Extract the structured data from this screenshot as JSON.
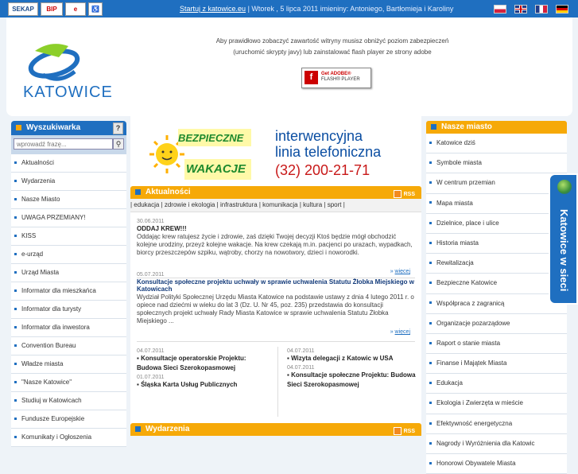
{
  "topbar": {
    "logos": [
      "SEKAP",
      "BIP",
      "e",
      "♿"
    ],
    "start_link": "Startuj z katowice.eu",
    "date_text": "| Wtorek , 5 lipca 2011 imieniny: Antoniego, Bartłomieja i Karoliny",
    "flags": [
      "pl-flag",
      "en-flag",
      "fr-flag",
      "de-flag"
    ]
  },
  "header": {
    "logo_text": "KATOWICE",
    "notice_line1": "Aby prawidłowo zobaczyć zawartość witryny musisz obniżyć poziom zabezpieczeń",
    "notice_line2": "(uruchomić skrypty javy) lub zainstalować flash player ze strony adobe",
    "flash_line1": "Get ADOBE®",
    "flash_line2": "FLASH® PLAYER"
  },
  "search": {
    "title": "Wyszukiwarka",
    "help": "?",
    "placeholder": "wprowadź frazę..."
  },
  "left_menu": [
    "Aktualności",
    "Wydarzenia",
    "Nasze Miasto",
    "UWAGA PRZEMIANY!",
    "KISS",
    "e-urząd",
    "Urząd Miasta",
    "Informator dla mieszkańca",
    "Informator dla turysty",
    "Informator dla inwestora",
    "Convention Bureau",
    "Władze miasta",
    "\"Nasze Katowice\"",
    "Studiuj w Katowicach",
    "Fundusze Europejskie",
    "Komunikaty i Ogłoszenia"
  ],
  "banner": {
    "bw1": "BEZPIECZNE",
    "bw2": "WAKACJE",
    "hot_line1": "interwencyjna",
    "hot_line2": "linia telefoniczna",
    "hot_phone": "(32) 200-21-71"
  },
  "news_section": {
    "title": "Aktualności",
    "rss": "RSS",
    "categories": "| edukacja | zdrowie i ekologia | infrastruktura | komunikacja | kultura | sport |",
    "item1": {
      "date": "30.06.2011",
      "title": "ODDAJ KREW!!!",
      "text": "Oddając krew ratujesz życie i zdrowie, zaś dzięki Twojej decyzji Ktoś będzie mógł obchodzić kolejne urodziny, przeyż kolejne wakacje. Na krew czekają m.in. pacjenci po urazach, wypadkach, biorcy przeszczepów szpiku, wątroby, chorzy na nowotwory, dzieci i noworodki.",
      "more": "więcej"
    },
    "item2": {
      "date": "05.07.2011",
      "title": "Konsultacje społeczne projektu uchwały w sprawie uchwalenia Statutu Żłobka Miejskiego w Katowicach",
      "text": "Wydział Polityki Społecznej Urzędu Miasta Katowice na podstawie ustawy z dnia 4 lutego 2011 r. o opiece nad dziećmi w wieku do lat 3 (Dz. U. Nr 45, poz. 235) przedstawia do konsultacji społecznych projekt uchwały Rady Miasta Katowice w sprawie uchwalenia Statutu Żłobka Miejskiego ...",
      "more": "więcej"
    },
    "left_col": [
      {
        "date": "04.07.2011",
        "title": "Konsultacje operatorskie Projektu: Budowa Sieci Szerokopasmowej"
      },
      {
        "date": "01.07.2011",
        "title": "Śląska Karta Usług Publicznych"
      }
    ],
    "right_col": [
      {
        "date": "04.07.2011",
        "title": "Wizyta delegacji z Katowic w USA"
      },
      {
        "date": "04.07.2011",
        "title": "Konsultacje społeczne Projektu: Budowa Sieci Szerokopasmowej"
      }
    ]
  },
  "events_section": {
    "title": "Wydarzenia",
    "rss": "RSS"
  },
  "right_section": {
    "title": "Nasze miasto",
    "items": [
      "Katowice dziś",
      "Symbole miasta",
      "W centrum przemian",
      "Mapa miasta",
      "Dzielnice, place i ulice",
      "Historia miasta",
      "Rewitalizacja",
      "Bezpieczne Katowice",
      "Współpraca z zagranicą",
      "Organizacje pozarządowe",
      "Raport o stanie miasta",
      "Finanse i Majątek Miasta",
      "Edukacja",
      "Ekologia i Zwierzęta w mieście",
      "Efektywność energetyczna",
      "Nagrody i Wyróżnienia dla Katowic",
      "Honorowi Obywatele Miasta"
    ]
  },
  "side_tab": {
    "label": "Katowice w sieci"
  },
  "colors": {
    "brand_blue": "#1f6fc0",
    "accent_orange": "#f6a908",
    "hotline_red": "#c81818"
  }
}
